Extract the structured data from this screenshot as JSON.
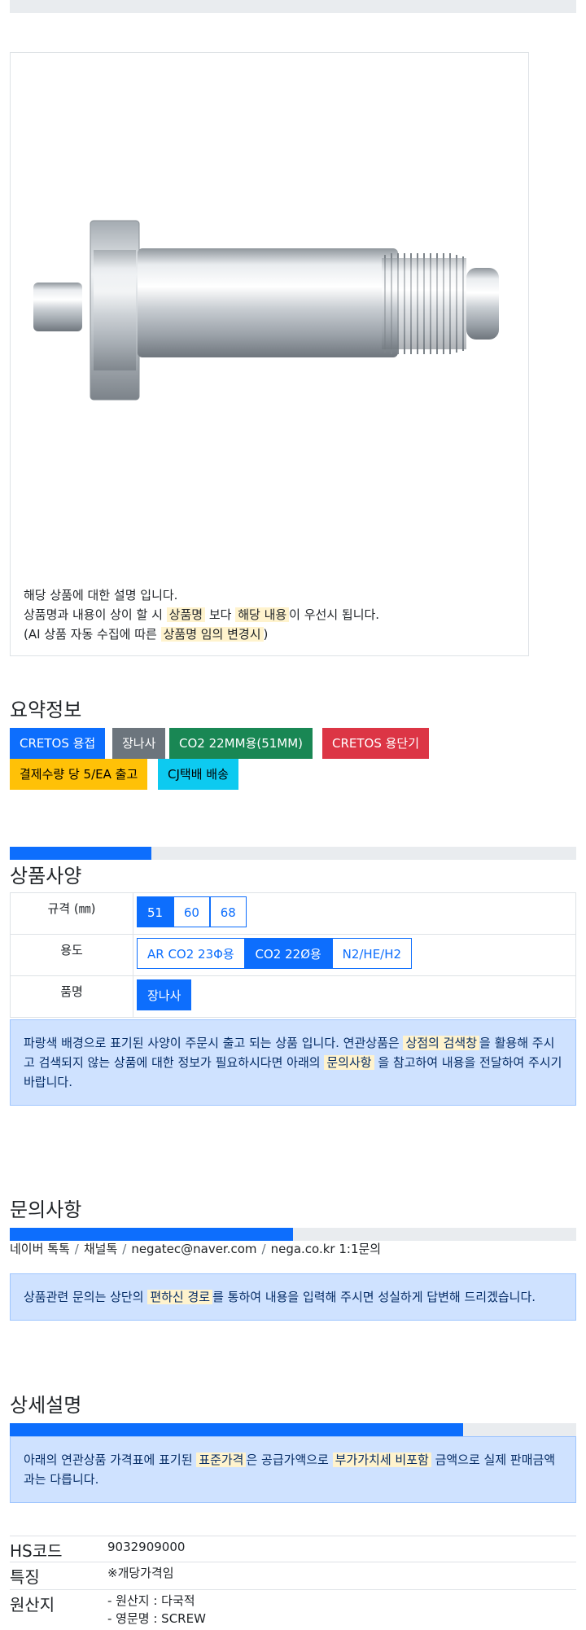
{
  "product_image": {
    "note_line1": "해당 상품에 대한 설명 입니다.",
    "note_line2_a": "상품명과 내용이 상이 할 시 ",
    "note_line2_hl1": "상품명",
    "note_line2_b": " 보다 ",
    "note_line2_hl2": "해당 내용",
    "note_line2_c": "이 우선시 됩니다.",
    "note_line3_a": "(AI 상품 자동 수집에 따른 ",
    "note_line3_hl": "상품명 임의 변경시",
    "note_line3_b": ")"
  },
  "summary": {
    "title": "요약정보",
    "badges": [
      "CRETOS 용접",
      "장나사",
      "CO2 22MM용(51MM)",
      "CRETOS 용단기",
      "결제수량 당 5/EA 출고",
      "CJ택배 배송"
    ]
  },
  "spec": {
    "title": "상품사양",
    "progress": 0.25,
    "rows": [
      {
        "label": "규격 (㎜)",
        "options": [
          "51",
          "60",
          "68"
        ],
        "selected": 0
      },
      {
        "label": "용도",
        "options": [
          "AR CO2 23Φ용",
          "CO2 22Ø용",
          "N2/HE/H2"
        ],
        "selected": 1
      },
      {
        "label": "품명",
        "options": [
          "장나사"
        ],
        "selected": 0
      }
    ],
    "notice_a": "파랑색 배경으로 표기된 사양이 주문시 출고 되는 상품 입니다. 연관상품은 ",
    "notice_hl1": "상점의 검색창",
    "notice_b": "을 활용해 주시고 검색되지 않는 상품에 대한 정보가 필요하시다면 아래의 ",
    "notice_hl2": "문의사항",
    "notice_c": " 을 참고하여 내용을 전달하여 주시기 바랍니다."
  },
  "inquiry": {
    "title": "문의사항",
    "progress": 0.5,
    "links": [
      "네이버 톡톡",
      "채널톡",
      "negatec@naver.com",
      "nega.co.kr 1:1문의"
    ],
    "notice_a": "상품관련 문의는 상단의 ",
    "notice_hl": "편하신 경로",
    "notice_b": "를 통하여 내용을 입력해 주시면 성실하게 답변해 드리겠습니다."
  },
  "detail": {
    "title": "상세설명",
    "progress": 0.8,
    "notice_a": "아래의 연관상품 가격표에 표기된 ",
    "notice_hl1": "표준가격",
    "notice_b": "은 공급가액으로 ",
    "notice_hl2": "부가가치세 비포함",
    "notice_c": " 금액으로 실제 판매금액과는 다릅니다."
  },
  "info": [
    {
      "key": "HS코드",
      "value": "9032909000"
    },
    {
      "key": "특징",
      "value": "※개당가격임"
    },
    {
      "key": "원산지",
      "value1": "- 원산지 : 다국적",
      "value2": "- 영문명 : SCREW"
    }
  ],
  "colors": {
    "primary": "#0d6efd",
    "secondary": "#6c757d",
    "success": "#198754",
    "danger": "#dc3545",
    "warning": "#ffc107",
    "info": "#0dcaf0"
  }
}
